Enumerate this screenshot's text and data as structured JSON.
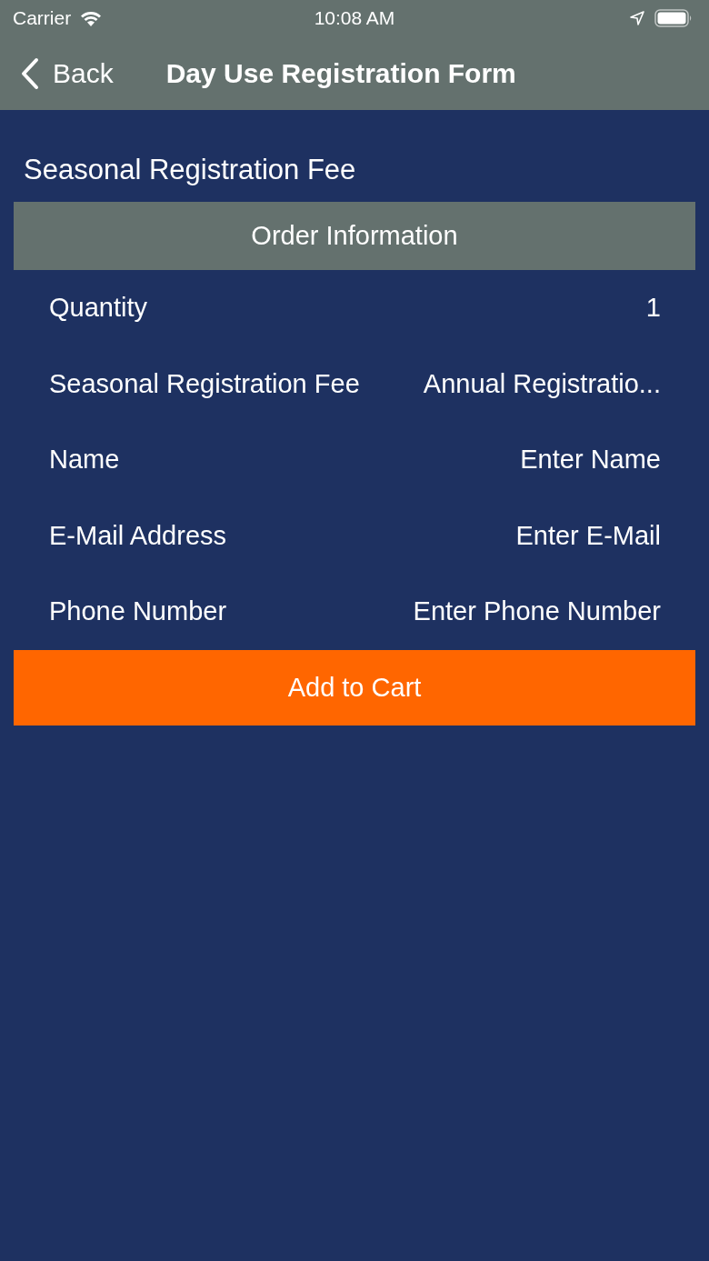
{
  "status_bar": {
    "carrier": "Carrier",
    "time": "10:08 AM"
  },
  "nav": {
    "back": "Back",
    "title": "Day Use Registration Form"
  },
  "section_title": "Seasonal Registration Fee",
  "order_header": "Order Information",
  "rows": [
    {
      "kind": "value",
      "label": "Quantity",
      "value": "1"
    },
    {
      "kind": "value",
      "label": "Seasonal Registration Fee",
      "value": "Annual Registratio..."
    },
    {
      "kind": "input",
      "label": "Name",
      "placeholder": "Enter Name"
    },
    {
      "kind": "input",
      "label": "E-Mail Address",
      "placeholder": "Enter E-Mail"
    },
    {
      "kind": "input",
      "label": "Phone Number",
      "placeholder": "Enter Phone Number"
    }
  ],
  "button": "Add to Cart"
}
